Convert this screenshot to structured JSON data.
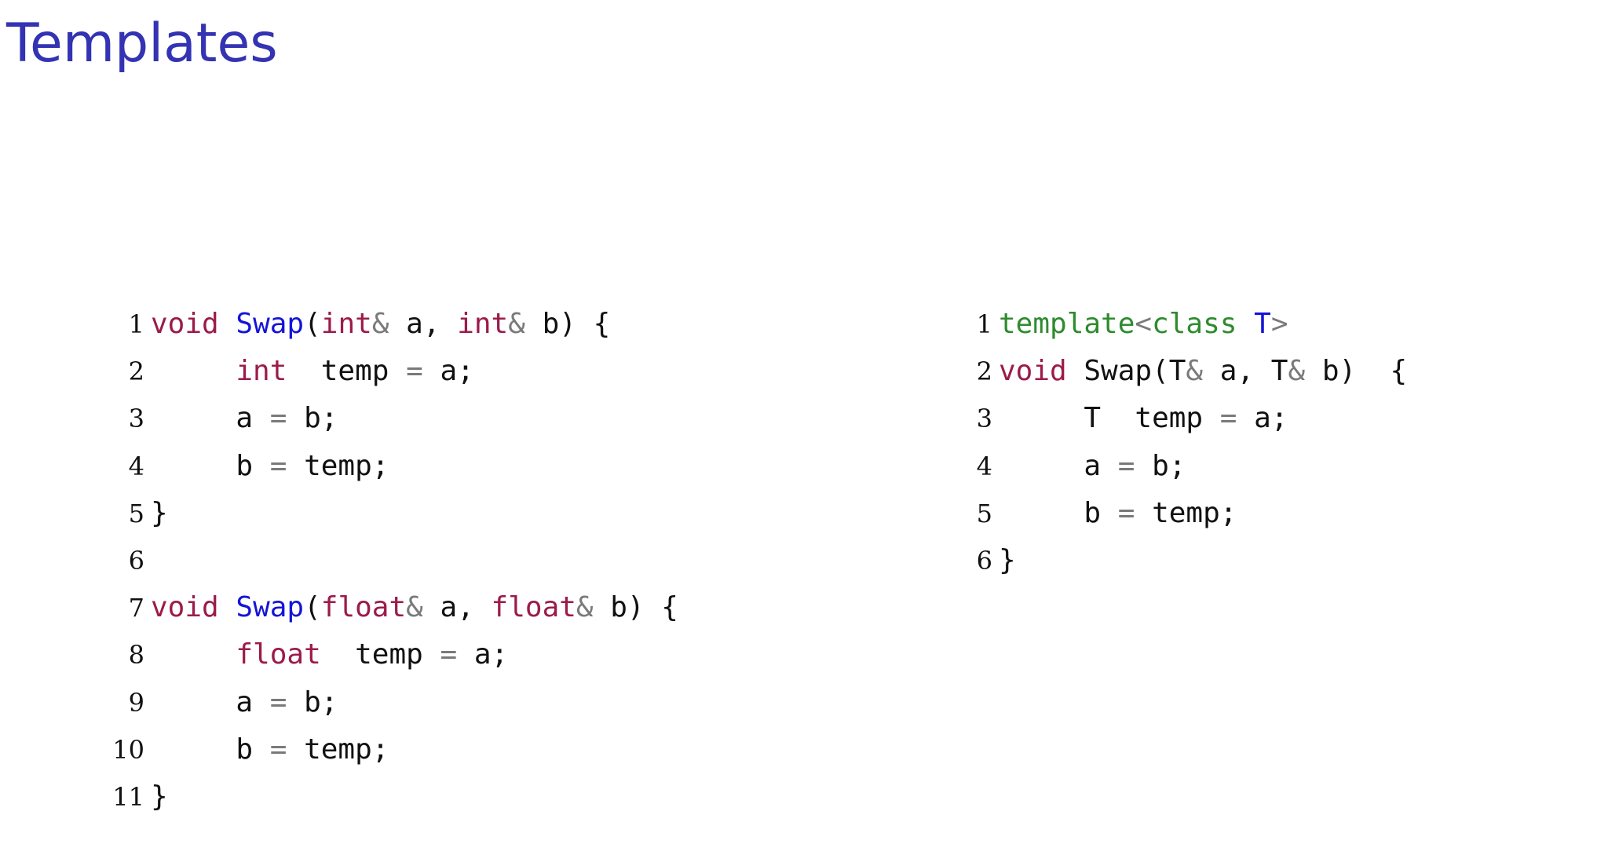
{
  "slide": {
    "title": "Templates"
  },
  "colors": {
    "title": "#3333b3",
    "keyword": "#9b1b4a",
    "function": "#1414d8",
    "template_keyword": "#2e8b2e",
    "type_param": "#1414d8",
    "operator": "#7a7a7a",
    "text": "#111111"
  },
  "left_listing": {
    "lines": [
      {
        "num": "1",
        "tokens": [
          {
            "t": "void",
            "c": "kw"
          },
          {
            "t": " ",
            "c": "plain"
          },
          {
            "t": "Swap",
            "c": "fn"
          },
          {
            "t": "(",
            "c": "plain"
          },
          {
            "t": "int",
            "c": "kw"
          },
          {
            "t": "&",
            "c": "op"
          },
          {
            "t": " a, ",
            "c": "plain"
          },
          {
            "t": "int",
            "c": "kw"
          },
          {
            "t": "&",
            "c": "op"
          },
          {
            "t": " b) {",
            "c": "plain"
          }
        ]
      },
      {
        "num": "2",
        "tokens": [
          {
            "t": "     ",
            "c": "plain"
          },
          {
            "t": "int",
            "c": "kw"
          },
          {
            "t": "  temp ",
            "c": "plain"
          },
          {
            "t": "=",
            "c": "op"
          },
          {
            "t": " a;",
            "c": "plain"
          }
        ]
      },
      {
        "num": "3",
        "tokens": [
          {
            "t": "     a ",
            "c": "plain"
          },
          {
            "t": "=",
            "c": "op"
          },
          {
            "t": " b;",
            "c": "plain"
          }
        ]
      },
      {
        "num": "4",
        "tokens": [
          {
            "t": "     b ",
            "c": "plain"
          },
          {
            "t": "=",
            "c": "op"
          },
          {
            "t": " temp;",
            "c": "plain"
          }
        ]
      },
      {
        "num": "5",
        "tokens": [
          {
            "t": "}",
            "c": "plain"
          }
        ]
      },
      {
        "num": "6",
        "tokens": []
      },
      {
        "num": "7",
        "tokens": [
          {
            "t": "void",
            "c": "kw"
          },
          {
            "t": " ",
            "c": "plain"
          },
          {
            "t": "Swap",
            "c": "fn"
          },
          {
            "t": "(",
            "c": "plain"
          },
          {
            "t": "float",
            "c": "kw"
          },
          {
            "t": "&",
            "c": "op"
          },
          {
            "t": " a, ",
            "c": "plain"
          },
          {
            "t": "float",
            "c": "kw"
          },
          {
            "t": "&",
            "c": "op"
          },
          {
            "t": " b) {",
            "c": "plain"
          }
        ]
      },
      {
        "num": "8",
        "tokens": [
          {
            "t": "     ",
            "c": "plain"
          },
          {
            "t": "float",
            "c": "kw"
          },
          {
            "t": "  temp ",
            "c": "plain"
          },
          {
            "t": "=",
            "c": "op"
          },
          {
            "t": " a;",
            "c": "plain"
          }
        ]
      },
      {
        "num": "9",
        "tokens": [
          {
            "t": "     a ",
            "c": "plain"
          },
          {
            "t": "=",
            "c": "op"
          },
          {
            "t": " b;",
            "c": "plain"
          }
        ]
      },
      {
        "num": "10",
        "tokens": [
          {
            "t": "     b ",
            "c": "plain"
          },
          {
            "t": "=",
            "c": "op"
          },
          {
            "t": " temp;",
            "c": "plain"
          }
        ]
      },
      {
        "num": "11",
        "tokens": [
          {
            "t": "}",
            "c": "plain"
          }
        ]
      }
    ]
  },
  "right_listing": {
    "lines": [
      {
        "num": "1",
        "tokens": [
          {
            "t": "template",
            "c": "tpl"
          },
          {
            "t": "<",
            "c": "op"
          },
          {
            "t": "class",
            "c": "tpl"
          },
          {
            "t": " ",
            "c": "plain"
          },
          {
            "t": "T",
            "c": "type"
          },
          {
            "t": ">",
            "c": "op"
          }
        ]
      },
      {
        "num": "2",
        "tokens": [
          {
            "t": "void",
            "c": "kw"
          },
          {
            "t": " Swap(T",
            "c": "plain"
          },
          {
            "t": "&",
            "c": "op"
          },
          {
            "t": " a, T",
            "c": "plain"
          },
          {
            "t": "&",
            "c": "op"
          },
          {
            "t": " b)  {",
            "c": "plain"
          }
        ]
      },
      {
        "num": "3",
        "tokens": [
          {
            "t": "     T  temp ",
            "c": "plain"
          },
          {
            "t": "=",
            "c": "op"
          },
          {
            "t": " a;",
            "c": "plain"
          }
        ]
      },
      {
        "num": "4",
        "tokens": [
          {
            "t": "     a ",
            "c": "plain"
          },
          {
            "t": "=",
            "c": "op"
          },
          {
            "t": " b;",
            "c": "plain"
          }
        ]
      },
      {
        "num": "5",
        "tokens": [
          {
            "t": "     b ",
            "c": "plain"
          },
          {
            "t": "=",
            "c": "op"
          },
          {
            "t": " temp;",
            "c": "plain"
          }
        ]
      },
      {
        "num": "6",
        "tokens": [
          {
            "t": "}",
            "c": "plain"
          }
        ]
      }
    ]
  }
}
